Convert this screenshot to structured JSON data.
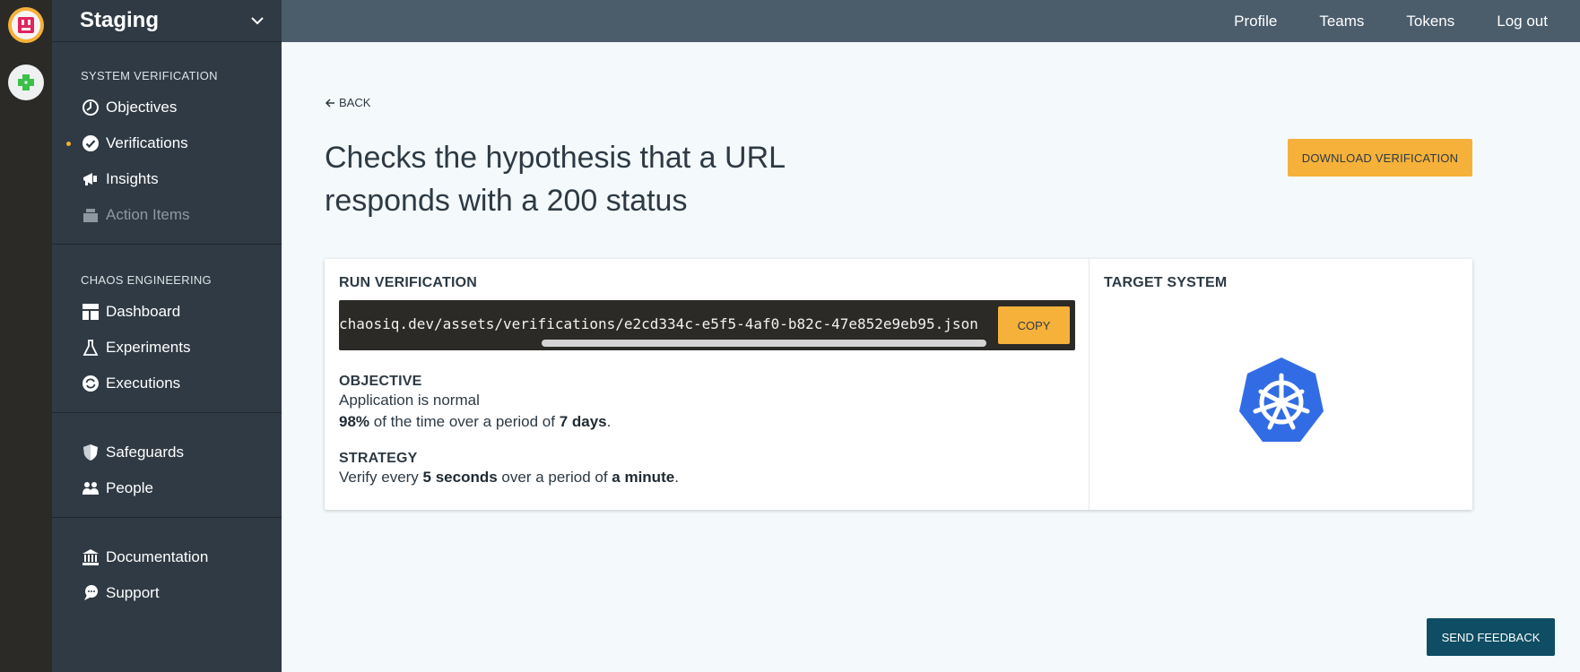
{
  "workspace": {
    "name": "Staging"
  },
  "orgs": [
    {
      "name": "org-icon-primary"
    },
    {
      "name": "org-icon-secondary"
    }
  ],
  "topbar": {
    "links": [
      "Profile",
      "Teams",
      "Tokens",
      "Log out"
    ]
  },
  "sidebar": {
    "sections": [
      {
        "label": "SYSTEM VERIFICATION",
        "items": [
          {
            "label": "Objectives",
            "icon": "objectives-icon"
          },
          {
            "label": "Verifications",
            "icon": "check-circle-icon",
            "active": true
          },
          {
            "label": "Insights",
            "icon": "megaphone-icon"
          },
          {
            "label": "Action Items",
            "icon": "tray-icon",
            "disabled": true
          }
        ]
      },
      {
        "label": "CHAOS ENGINEERING",
        "items": [
          {
            "label": "Dashboard",
            "icon": "dashboard-icon"
          },
          {
            "label": "Experiments",
            "icon": "flask-icon"
          },
          {
            "label": "Executions",
            "icon": "refresh-icon"
          }
        ]
      },
      {
        "label": "",
        "items": [
          {
            "label": "Safeguards",
            "icon": "shield-icon"
          },
          {
            "label": "People",
            "icon": "people-icon"
          }
        ]
      },
      {
        "label": "",
        "items": [
          {
            "label": "Documentation",
            "icon": "bank-icon"
          },
          {
            "label": "Support",
            "icon": "chat-icon"
          }
        ]
      }
    ]
  },
  "main": {
    "back_label": "BACK",
    "title": "Checks the hypothesis that a URL responds with a 200 status",
    "download_label": "DOWNLOAD VERIFICATION",
    "run": {
      "heading": "RUN VERIFICATION",
      "command": "chaosiq.dev/assets/verifications/e2cd334c-e5f5-4af0-b82c-47e852e9eb95.json",
      "copy_label": "COPY"
    },
    "objective": {
      "heading": "OBJECTIVE",
      "name": "Application is normal",
      "percent": "98%",
      "mid": " of the time over a period of ",
      "period": "7 days",
      "end": "."
    },
    "strategy": {
      "heading": "STRATEGY",
      "pre": "Verify every ",
      "interval": "5 seconds",
      "mid": " over a period of ",
      "duration": "a minute",
      "end": "."
    },
    "target": {
      "heading": "TARGET SYSTEM",
      "icon": "kubernetes-icon"
    }
  },
  "feedback_label": "SEND FEEDBACK",
  "colors": {
    "accent": "#f6b13a",
    "sidebar": "#2f3a44",
    "topbar": "#4b5c6b",
    "feedback": "#0e4d63",
    "k8s": "#326ce5"
  }
}
